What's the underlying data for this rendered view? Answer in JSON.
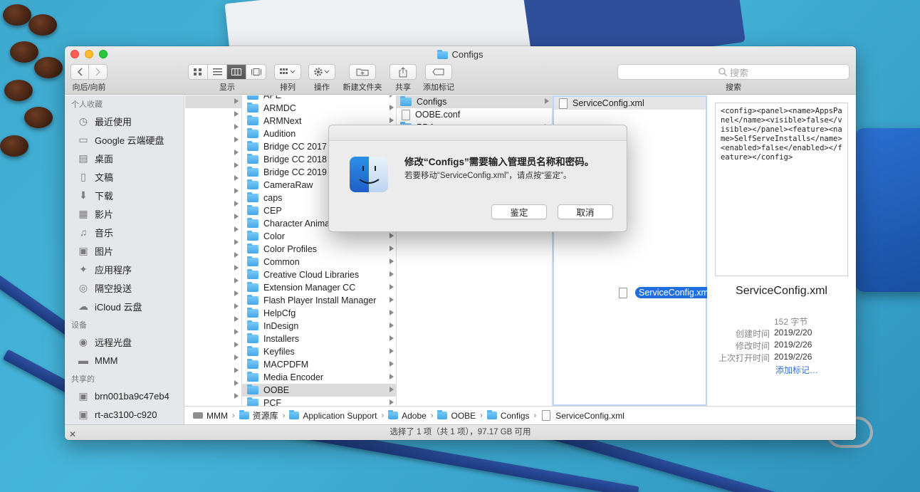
{
  "window": {
    "title": "Configs"
  },
  "toolbar": {
    "nav_label": "向后/向前",
    "view_label": "显示",
    "arrange_label": "排列",
    "action_label": "操作",
    "new_folder_label": "新建文件夹",
    "share_label": "共享",
    "tags_label": "添加标记",
    "search_label": "搜索",
    "search_placeholder": "搜索"
  },
  "sidebar": {
    "favorites_header": "个人收藏",
    "favorites": [
      {
        "label": "最近使用",
        "icon": "clock-icon"
      },
      {
        "label": "Google 云端硬盘",
        "icon": "drive-icon"
      },
      {
        "label": "桌面",
        "icon": "desktop-icon"
      },
      {
        "label": "文稿",
        "icon": "document-icon"
      },
      {
        "label": "下载",
        "icon": "download-icon"
      },
      {
        "label": "影片",
        "icon": "film-icon"
      },
      {
        "label": "音乐",
        "icon": "music-icon"
      },
      {
        "label": "图片",
        "icon": "camera-icon"
      },
      {
        "label": "应用程序",
        "icon": "apps-icon"
      },
      {
        "label": "隔空投送",
        "icon": "airdrop-icon"
      },
      {
        "label": "iCloud 云盘",
        "icon": "cloud-icon"
      }
    ],
    "devices_header": "设备",
    "devices": [
      {
        "label": "远程光盘",
        "icon": "disc-icon"
      },
      {
        "label": "MMM",
        "icon": "harddisk-icon"
      }
    ],
    "shared_header": "共享的",
    "shared": [
      {
        "label": "brn001ba9c47eb4",
        "icon": "monitor-icon"
      },
      {
        "label": "rt-ac3100-c920",
        "icon": "monitor-icon"
      }
    ]
  },
  "column2": [
    "APE",
    "ARMDC",
    "ARMNext",
    "Audition",
    "Bridge CC 2017",
    "Bridge CC 2018",
    "Bridge CC 2019",
    "CameraRaw",
    "caps",
    "CEP",
    "Character Animator",
    "Color",
    "Color Profiles",
    "Common",
    "Creative Cloud Libraries",
    "Extension Manager CC",
    "Flash Player Install Manager",
    "HelpCfg",
    "InDesign",
    "Installers",
    "Keyfiles",
    "MACPDFM",
    "Media Encoder",
    "OOBE",
    "PCF"
  ],
  "column3": [
    "Configs",
    "OOBE.conf",
    "PDApp"
  ],
  "column4": [
    "ServiceConfig.xml"
  ],
  "drag_item": "ServiceConfig.xml",
  "preview": {
    "content": "<config><panel><name>AppsPanel</name><visible>false</visible></panel><feature><name>SelfServeInstalls</name><enabled>false</enabled></feature></config>",
    "filename": "ServiceConfig.xml",
    "size": "152 字节",
    "created_label": "创建时间",
    "created": "2019/2/20",
    "modified_label": "修改时间",
    "modified": "2019/2/26",
    "opened_label": "上次打开时间",
    "opened": "2019/2/26",
    "add_tags": "添加标记…"
  },
  "pathbar": [
    "MMM",
    "资源库",
    "Application Support",
    "Adobe",
    "OOBE",
    "Configs",
    "ServiceConfig.xml"
  ],
  "status": "选择了 1 项（共 1 项），97.17 GB 可用",
  "dialog": {
    "title": "修改“Configs”需要输入管理员名称和密码。",
    "message": "若要移动“ServiceConfig.xml”，请点按“鉴定”。",
    "ok": "鉴定",
    "cancel": "取消"
  },
  "colors": {
    "accent": "#1f6fe0",
    "folder": "#45a8ea"
  }
}
